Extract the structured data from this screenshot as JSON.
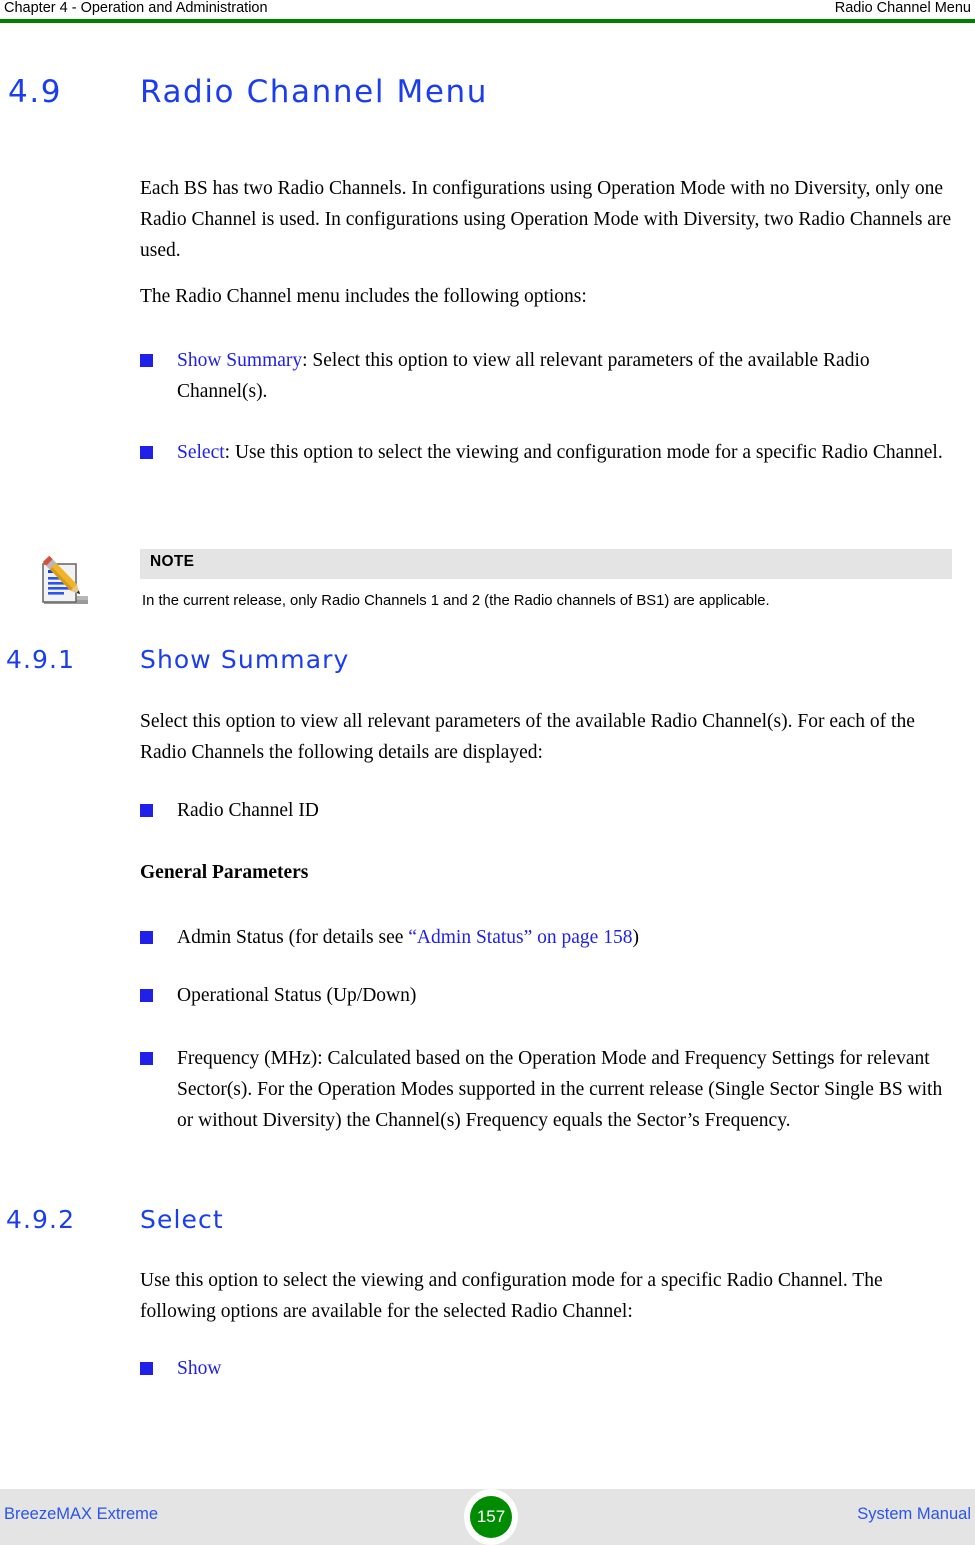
{
  "header": {
    "left": "Chapter 4 - Operation and Administration",
    "right": "Radio Channel Menu",
    "rule_color": "#008000"
  },
  "section": {
    "number": "4.9",
    "title": "Radio Channel Menu",
    "intro_paragraph": "Each BS has two Radio Channels. In configurations using Operation Mode with no Diversity, only one Radio Channel is used. In configurations using Operation Mode with Diversity, two Radio Channels are used.",
    "options_lead": "The Radio Channel menu includes the following options:",
    "options": [
      {
        "term": "Show Summary",
        "rest": ": Select this option to view all relevant parameters of the available Radio Channel(s)."
      },
      {
        "term": "Select",
        "rest": ": Use this option to select the viewing and configuration mode for a specific Radio Channel."
      }
    ]
  },
  "note": {
    "icon": "note-pencil-icon",
    "label": "NOTE",
    "text": "In the current release, only Radio Channels 1 and 2 (the Radio channels of BS1) are applicable.",
    "bar_color": "#e4e4e4"
  },
  "subsection_491": {
    "number": "4.9.1",
    "title": "Show Summary",
    "intro": "Select this option to view all relevant parameters of the available Radio Channel(s). For each of the Radio Channels the following details are displayed:",
    "bullet_id": "Radio Channel ID",
    "group_heading": "General Parameters",
    "bullets": [
      {
        "pre": "Admin Status (for details see ",
        "link": "“Admin Status” on page 158",
        "post": ")"
      },
      {
        "pre": "Operational Status (Up/Down)",
        "link": "",
        "post": ""
      },
      {
        "pre": "Frequency (MHz): Calculated based on the Operation Mode and Frequency Settings for relevant Sector(s). For the Operation Modes supported in the current release (Single Sector Single BS with or without Diversity) the Channel(s) Frequency equals the Sector’s Frequency.",
        "link": "",
        "post": ""
      }
    ]
  },
  "subsection_492": {
    "number": "4.9.2",
    "title": "Select",
    "intro": "Use this option to select the viewing and configuration mode for a specific Radio Channel. The following options are available for the selected Radio Channel:",
    "bullets": [
      {
        "label": "Show"
      }
    ]
  },
  "footer": {
    "left": "BreezeMAX Extreme",
    "page_number": "157",
    "right": "System Manual",
    "badge_color": "#008c00",
    "band_color": "#e4e4e4"
  },
  "colors": {
    "heading_blue": "#1a3df0",
    "bullet_blue": "#2020e8",
    "link_blue": "#2020e8",
    "footer_blue": "#2a55e8",
    "rule_green": "#008000"
  }
}
